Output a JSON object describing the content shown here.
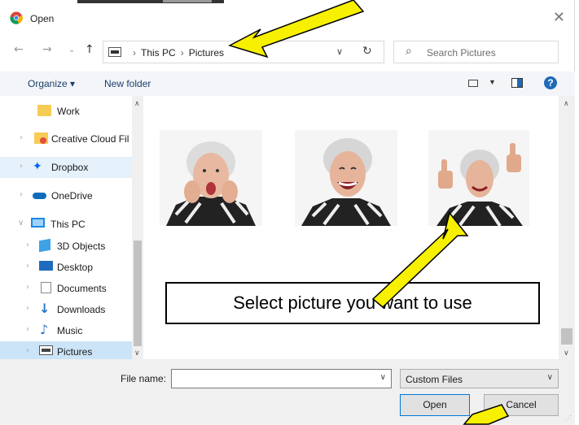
{
  "window": {
    "title": "Open",
    "close_glyph": "✕"
  },
  "nav": {
    "back_glyph": "←",
    "forward_glyph": "→",
    "recent_glyph": "⌄",
    "up_glyph": "↑",
    "breadcrumbs": [
      "This PC",
      "Pictures"
    ],
    "refresh_glyph": "↻",
    "search_placeholder": "Search Pictures",
    "search_glyph": "⌕"
  },
  "toolbar": {
    "organize_label": "Organize ▾",
    "new_folder_label": "New folder",
    "help_label": "?"
  },
  "sidebar": {
    "items": [
      {
        "label": "Work",
        "icon": "folder-icon"
      },
      {
        "label": "Creative Cloud Fil",
        "icon": "creative-cloud-icon"
      },
      {
        "label": "Dropbox",
        "icon": "dropbox-icon"
      },
      {
        "label": "OneDrive",
        "icon": "onedrive-icon"
      },
      {
        "label": "This PC",
        "icon": "computer-icon"
      },
      {
        "label": "3D Objects",
        "icon": "cube-icon"
      },
      {
        "label": "Desktop",
        "icon": "desktop-icon"
      },
      {
        "label": "Documents",
        "icon": "document-icon"
      },
      {
        "label": "Downloads",
        "icon": "download-icon"
      },
      {
        "label": "Music",
        "icon": "music-icon"
      },
      {
        "label": "Pictures",
        "icon": "pictures-icon"
      }
    ]
  },
  "content": {
    "callout_text": "Select picture you want to use"
  },
  "footer": {
    "filename_label": "File name:",
    "filename_value": "",
    "filter_value": "Custom Files",
    "open_label": "Open",
    "cancel_label": "Cancel"
  },
  "colors": {
    "selection": "#cce4f7",
    "hover": "#e5f1fb",
    "arrow_fill": "#f7f000",
    "accent": "#0078d7"
  }
}
